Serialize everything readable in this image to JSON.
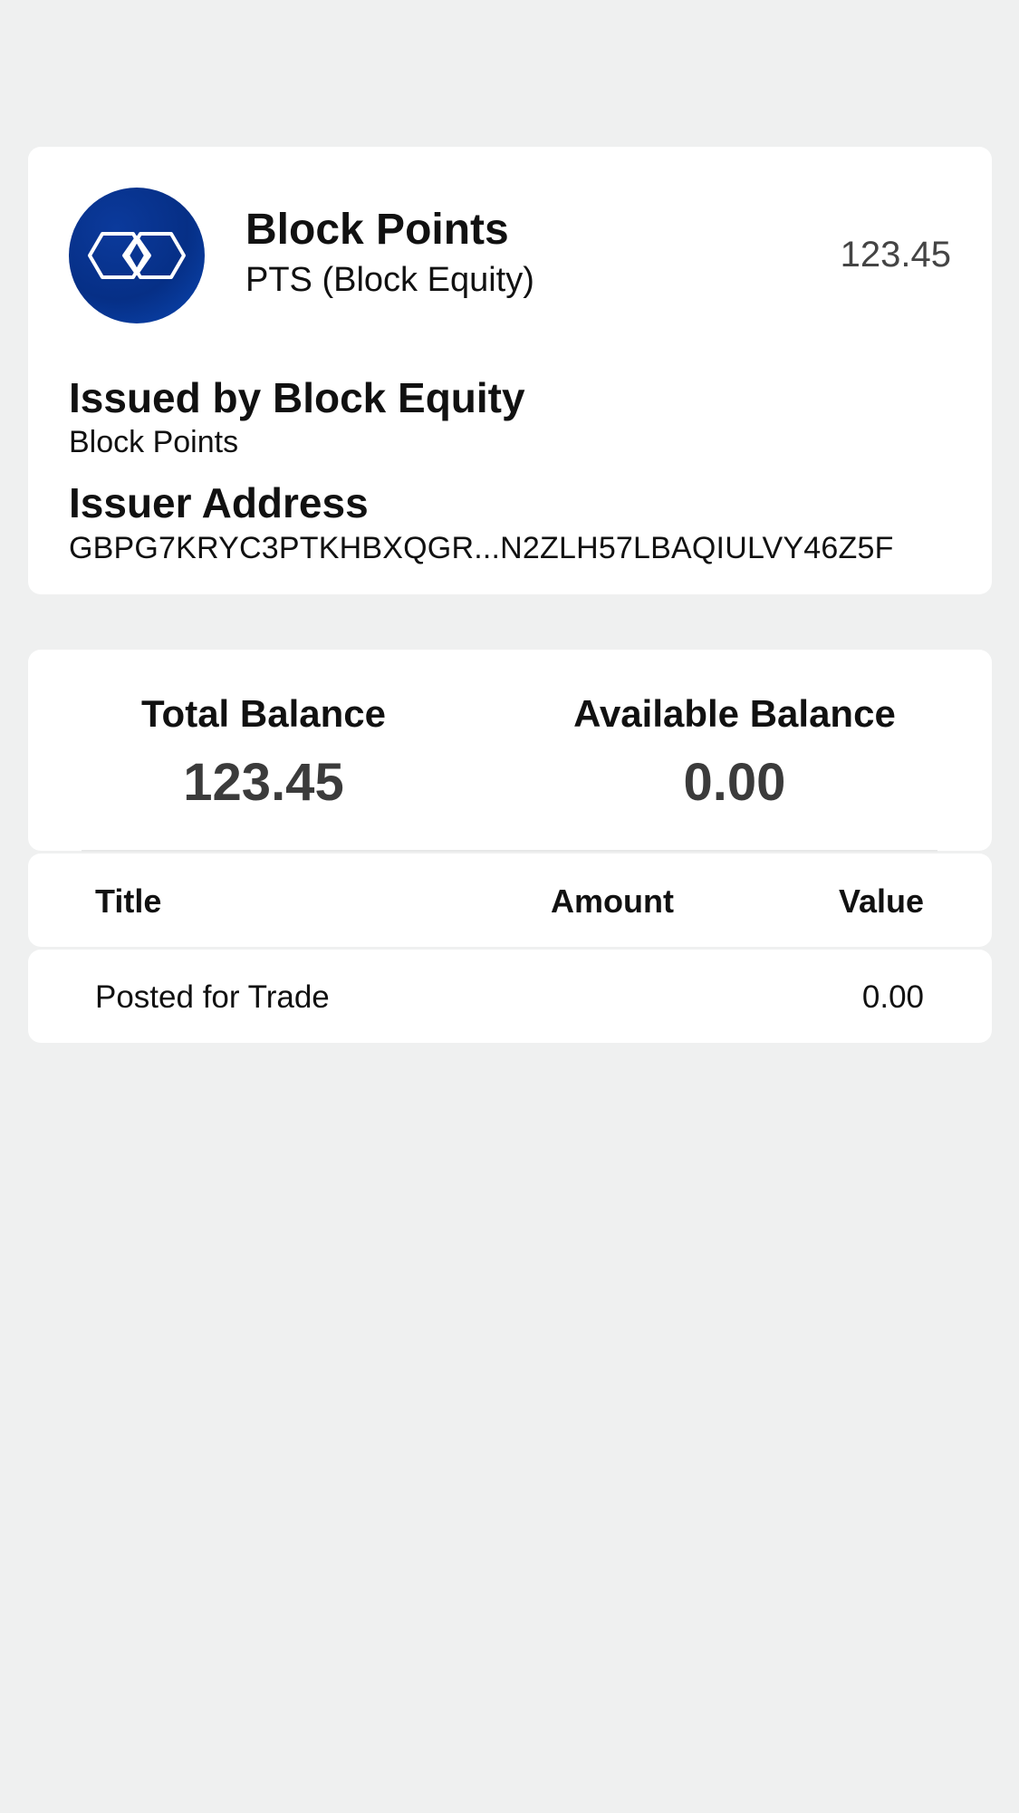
{
  "asset": {
    "name": "Block Points",
    "code_line": "PTS (Block Equity)",
    "amount": "123.45",
    "logo_icon": "block-equity-logo",
    "logo_color": "#062f86"
  },
  "issuer": {
    "issued_label": "Issued by Block Equity",
    "issued_value": "Block Points",
    "address_label": "Issuer Address",
    "address_value": "GBPG7KRYC3PTKHBXQGR...N2ZLH57LBAQIULVY46Z5F"
  },
  "balances": {
    "total_label": "Total Balance",
    "total_value": "123.45",
    "available_label": "Available Balance",
    "available_value": "0.00"
  },
  "table": {
    "headers": {
      "title": "Title",
      "amount": "Amount",
      "value": "Value"
    },
    "rows": [
      {
        "title": "Posted for Trade",
        "amount": "",
        "value": "0.00"
      }
    ]
  }
}
